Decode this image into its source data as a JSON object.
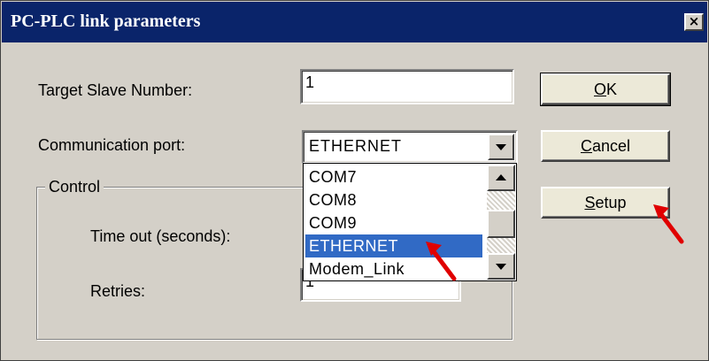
{
  "window": {
    "title": "PC-PLC link parameters",
    "close_glyph": "×"
  },
  "target_slave": {
    "label": "Target Slave Number:",
    "value": "1"
  },
  "comm_port": {
    "label": "Communication port:",
    "value": "ETHERNET",
    "options": [
      "COM7",
      "COM8",
      "COM9",
      "ETHERNET",
      "Modem_Link"
    ],
    "selected_index": 3,
    "list_scroll_position": 0.55
  },
  "control": {
    "legend": "Control",
    "timeout_label": "Time out (seconds):",
    "retries_label": "Retries:",
    "retries_value": "1"
  },
  "buttons": {
    "ok": {
      "mnemonic": "O",
      "rest": "K"
    },
    "cancel": {
      "mnemonic": "C",
      "rest": "ancel"
    },
    "setup": {
      "mnemonic": "S",
      "rest": "etup"
    }
  },
  "annotation": {
    "arrow_color": "#e00000"
  },
  "theme": {
    "titlebar": "#0a246a",
    "selection": "#316ac5",
    "face": "#d4d0c8"
  }
}
